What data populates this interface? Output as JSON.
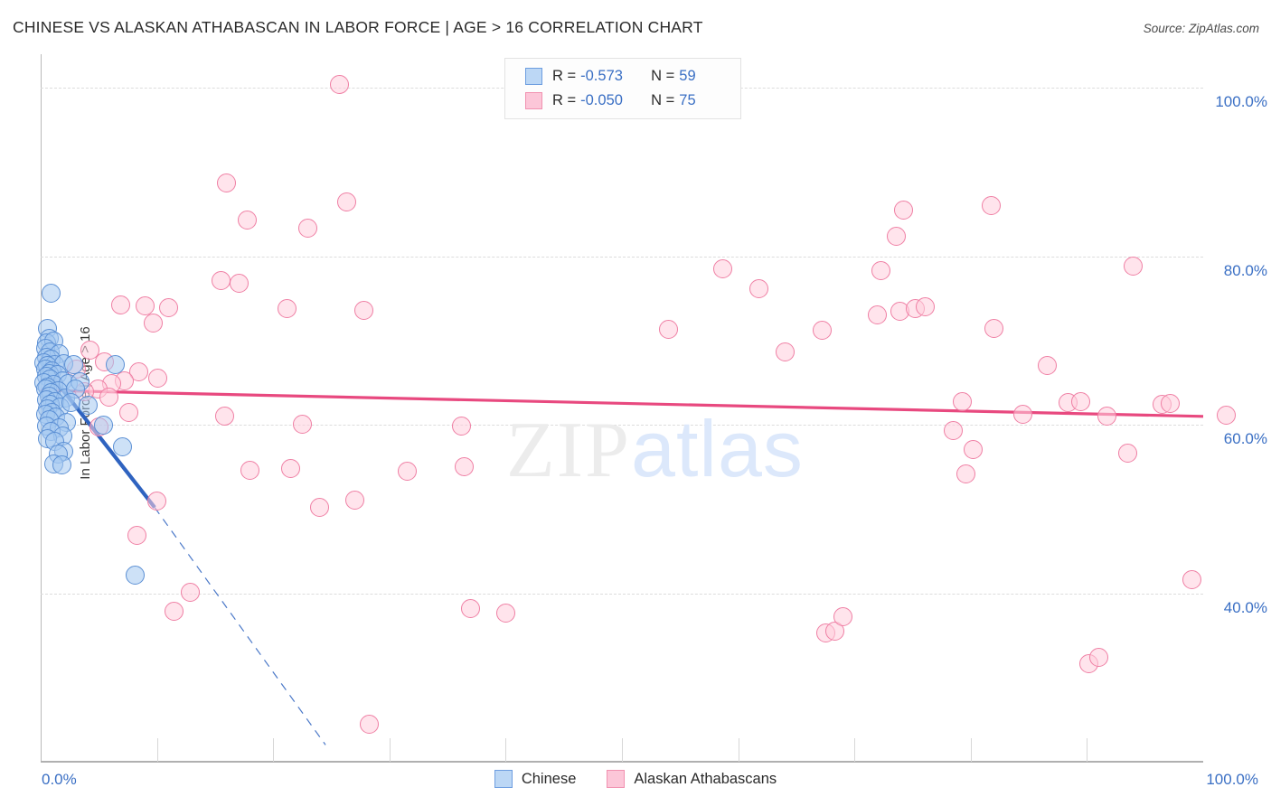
{
  "header": {
    "title": "CHINESE VS ALASKAN ATHABASCAN IN LABOR FORCE | AGE > 16 CORRELATION CHART",
    "source": "Source: ZipAtlas.com"
  },
  "watermark": {
    "part1": "ZIP",
    "part2": "atlas"
  },
  "stats_legend": {
    "rows": [
      {
        "series": "Chinese",
        "color": "#bcd7f5",
        "r_label": "R =",
        "r_value": "-0.573",
        "n_label": "N =",
        "n_value": "59"
      },
      {
        "series": "Alaskan Athabascans",
        "color": "#fcc6d8",
        "r_label": "R =",
        "r_value": "-0.050",
        "n_label": "N =",
        "n_value": "75"
      }
    ]
  },
  "series_legend": [
    {
      "label": "Chinese",
      "color": "#bcd7f5"
    },
    {
      "label": "Alaskan Athabascans",
      "color": "#fcc6d8"
    }
  ],
  "chart_data": {
    "type": "scatter",
    "title": "CHINESE VS ALASKAN ATHABASCAN IN LABOR FORCE | AGE > 16 CORRELATION CHART",
    "xlabel": "",
    "ylabel": "In Labor Force | Age > 16",
    "xlim": [
      0,
      100
    ],
    "ylim": [
      20,
      104
    ],
    "grid": true,
    "legend_position": "bottom-center",
    "x_ticks": [
      "0.0%",
      "100.0%"
    ],
    "x_tick_values": [
      0,
      100
    ],
    "y_ticks": [
      "40.0%",
      "60.0%",
      "80.0%",
      "100.0%"
    ],
    "y_tick_values": [
      40,
      60,
      80,
      100
    ],
    "accent_colors": {
      "blue_fill": "#a4c8f0",
      "blue_edge": "#5b8fd4",
      "pink_fill": "#ffcddd",
      "pink_edge": "#ef7fa4",
      "blue_line": "#2f63c0",
      "pink_line": "#e8497f",
      "tick_text": "#3a6fc4"
    },
    "series": [
      {
        "name": "Chinese",
        "color": "#a4c8f0",
        "r": -0.573,
        "n": 59,
        "trendline": {
          "x0": 0.0,
          "y0": 67.5,
          "x1": 9.8,
          "y1": 50.2,
          "dashed_to": {
            "x": 24.5,
            "y": 22.0
          }
        },
        "points": [
          [
            0.9,
            75.6
          ],
          [
            0.6,
            71.4
          ],
          [
            0.7,
            70.3
          ],
          [
            0.5,
            69.7
          ],
          [
            1.1,
            69.9
          ],
          [
            0.4,
            69.1
          ],
          [
            0.8,
            68.6
          ],
          [
            1.6,
            68.4
          ],
          [
            0.5,
            68.0
          ],
          [
            0.9,
            67.8
          ],
          [
            0.3,
            67.4
          ],
          [
            1.2,
            67.2
          ],
          [
            0.6,
            67.0
          ],
          [
            2.0,
            67.3
          ],
          [
            0.4,
            66.6
          ],
          [
            1.0,
            66.4
          ],
          [
            0.7,
            66.1
          ],
          [
            1.4,
            66.0
          ],
          [
            0.5,
            65.8
          ],
          [
            2.8,
            67.1
          ],
          [
            6.4,
            67.2
          ],
          [
            0.8,
            65.4
          ],
          [
            1.9,
            65.2
          ],
          [
            0.3,
            65.0
          ],
          [
            1.1,
            64.8
          ],
          [
            0.6,
            64.5
          ],
          [
            2.4,
            64.9
          ],
          [
            0.4,
            64.2
          ],
          [
            1.5,
            64.0
          ],
          [
            0.9,
            63.8
          ],
          [
            3.4,
            65.1
          ],
          [
            0.7,
            63.4
          ],
          [
            2.1,
            63.2
          ],
          [
            0.5,
            63.0
          ],
          [
            1.2,
            62.7
          ],
          [
            3.0,
            64.3
          ],
          [
            0.8,
            62.4
          ],
          [
            1.7,
            62.1
          ],
          [
            0.6,
            61.9
          ],
          [
            2.6,
            62.6
          ],
          [
            1.0,
            61.5
          ],
          [
            0.4,
            61.2
          ],
          [
            4.1,
            62.3
          ],
          [
            1.3,
            60.9
          ],
          [
            0.7,
            60.6
          ],
          [
            2.2,
            60.3
          ],
          [
            0.5,
            59.9
          ],
          [
            1.6,
            59.6
          ],
          [
            0.9,
            59.2
          ],
          [
            1.9,
            58.7
          ],
          [
            0.6,
            58.3
          ],
          [
            1.2,
            58.0
          ],
          [
            5.4,
            60.0
          ],
          [
            2.0,
            56.8
          ],
          [
            1.5,
            56.5
          ],
          [
            7.0,
            57.4
          ],
          [
            1.1,
            55.4
          ],
          [
            1.8,
            55.2
          ],
          [
            8.1,
            42.2
          ]
        ]
      },
      {
        "name": "Alaskan Athabascans",
        "color": "#ffcddd",
        "r": -0.05,
        "n": 75,
        "trendline": {
          "x0": 0.0,
          "y0": 64.1,
          "x1": 100.0,
          "y1": 61.0
        },
        "points": [
          [
            25.7,
            100.4
          ],
          [
            16.0,
            88.7
          ],
          [
            26.3,
            86.5
          ],
          [
            17.8,
            84.3
          ],
          [
            23.0,
            83.4
          ],
          [
            74.2,
            85.5
          ],
          [
            81.8,
            86.0
          ],
          [
            73.6,
            82.4
          ],
          [
            58.7,
            78.5
          ],
          [
            72.3,
            78.3
          ],
          [
            94.0,
            78.8
          ],
          [
            15.5,
            77.1
          ],
          [
            17.1,
            76.8
          ],
          [
            61.8,
            76.2
          ],
          [
            6.9,
            74.2
          ],
          [
            9.0,
            74.1
          ],
          [
            11.0,
            73.9
          ],
          [
            9.7,
            72.1
          ],
          [
            21.2,
            73.8
          ],
          [
            27.8,
            73.6
          ],
          [
            73.9,
            73.5
          ],
          [
            75.2,
            73.8
          ],
          [
            76.1,
            74.0
          ],
          [
            72.0,
            73.1
          ],
          [
            54.0,
            71.3
          ],
          [
            67.2,
            71.2
          ],
          [
            82.0,
            71.4
          ],
          [
            64.0,
            68.6
          ],
          [
            86.6,
            67.0
          ],
          [
            4.2,
            68.9
          ],
          [
            5.5,
            67.5
          ],
          [
            3.1,
            66.6
          ],
          [
            8.4,
            66.3
          ],
          [
            10.1,
            65.5
          ],
          [
            7.2,
            65.2
          ],
          [
            6.1,
            64.9
          ],
          [
            4.9,
            64.2
          ],
          [
            3.8,
            63.9
          ],
          [
            5.9,
            63.3
          ],
          [
            79.3,
            62.7
          ],
          [
            88.4,
            62.6
          ],
          [
            89.5,
            62.8
          ],
          [
            96.5,
            62.4
          ],
          [
            97.2,
            62.5
          ],
          [
            84.5,
            61.3
          ],
          [
            91.7,
            61.0
          ],
          [
            102.0,
            61.1
          ],
          [
            7.6,
            61.5
          ],
          [
            15.8,
            61.0
          ],
          [
            22.5,
            60.1
          ],
          [
            36.2,
            59.9
          ],
          [
            78.5,
            59.3
          ],
          [
            80.2,
            57.1
          ],
          [
            93.5,
            56.6
          ],
          [
            18.0,
            54.6
          ],
          [
            21.5,
            54.8
          ],
          [
            31.5,
            54.5
          ],
          [
            36.4,
            55.0
          ],
          [
            79.6,
            54.2
          ],
          [
            10.0,
            51.0
          ],
          [
            24.0,
            50.2
          ],
          [
            27.0,
            51.1
          ],
          [
            8.3,
            46.9
          ],
          [
            12.9,
            40.1
          ],
          [
            11.5,
            37.9
          ],
          [
            99.0,
            41.6
          ],
          [
            37.0,
            38.2
          ],
          [
            40.0,
            37.6
          ],
          [
            67.5,
            35.3
          ],
          [
            68.3,
            35.5
          ],
          [
            69.0,
            37.2
          ],
          [
            90.2,
            31.6
          ],
          [
            91.0,
            32.4
          ],
          [
            28.3,
            24.5
          ],
          [
            5.0,
            59.8
          ]
        ]
      }
    ]
  },
  "axis": {
    "y_title": "In Labor Force | Age > 16",
    "x_left": "0.0%",
    "x_right": "100.0%"
  }
}
